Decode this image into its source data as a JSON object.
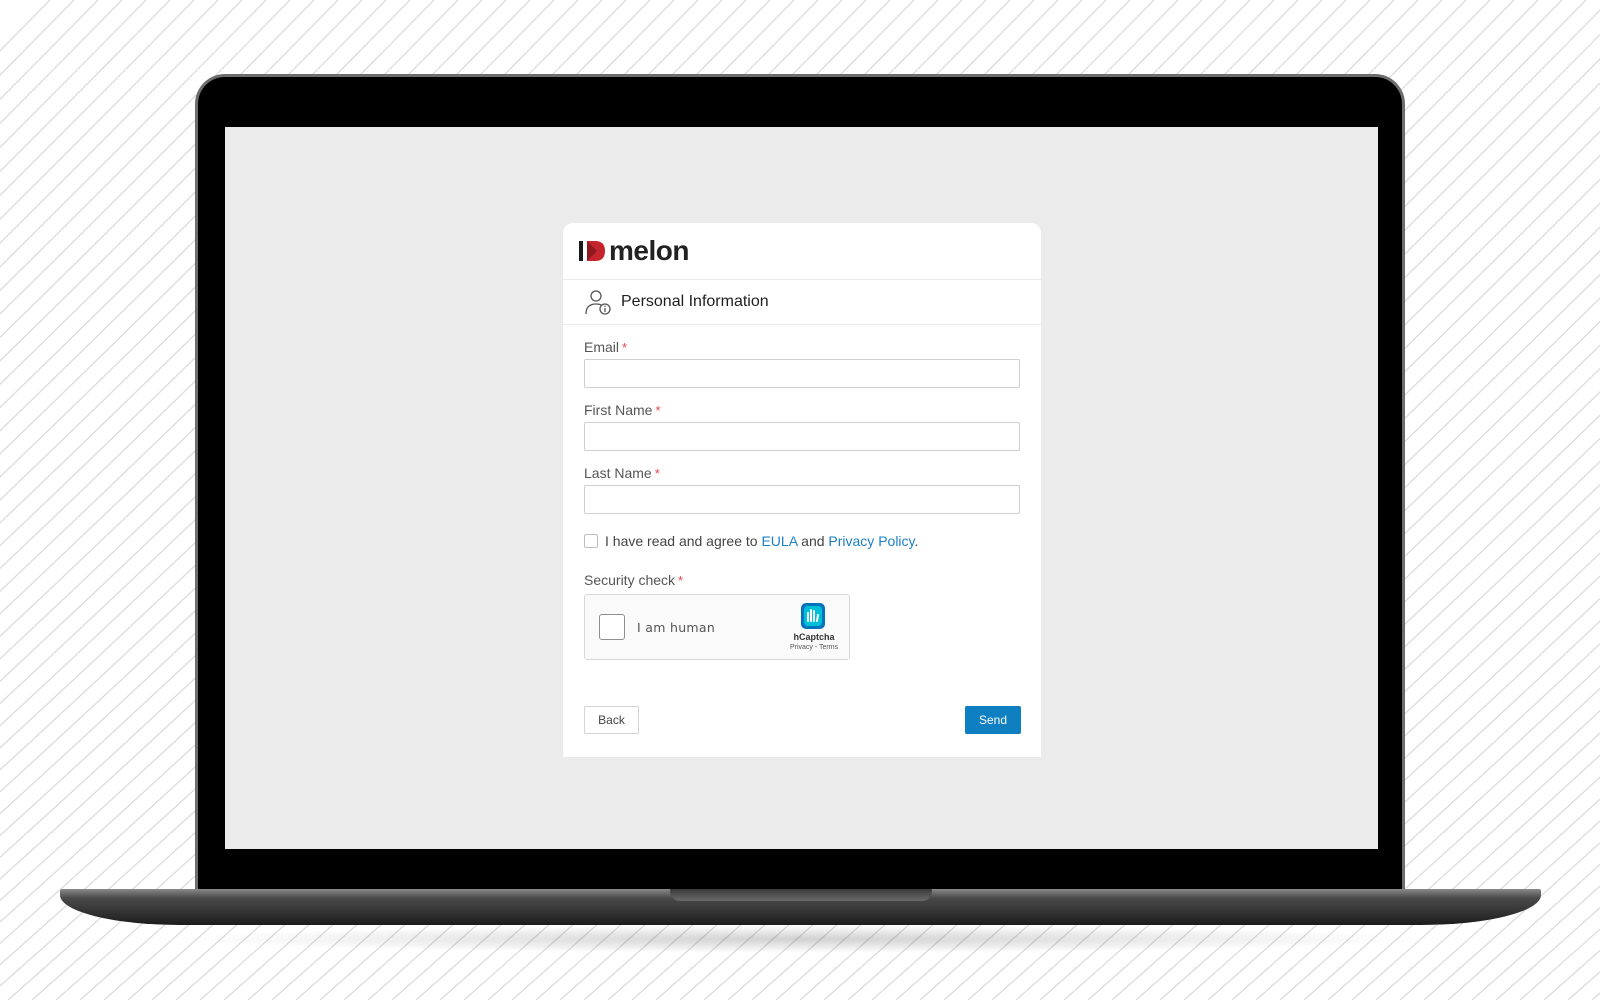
{
  "brand": {
    "logo_text": "melon",
    "accent": "#c4242c"
  },
  "section": {
    "title": "Personal Information",
    "icon": "user-info-icon"
  },
  "form": {
    "email_label": "Email",
    "first_name_label": "First Name",
    "last_name_label": "Last Name",
    "required_mark": "*",
    "email_value": "",
    "first_name_value": "",
    "last_name_value": "",
    "agree_text_1": "I have read and agree to ",
    "eula_link": "EULA",
    "agree_text_2": " and ",
    "privacy_link": "Privacy Policy",
    "agree_text_3": ".",
    "security_label": "Security check"
  },
  "captcha": {
    "label": "I am human",
    "brand": "hCaptcha",
    "links": "Privacy - Terms"
  },
  "actions": {
    "back_label": "Back",
    "send_label": "Send"
  },
  "colors": {
    "primary": "#0e7fc0",
    "link": "#1b7fc4",
    "required": "#e0434f",
    "screen_bg": "#ebebeb"
  }
}
